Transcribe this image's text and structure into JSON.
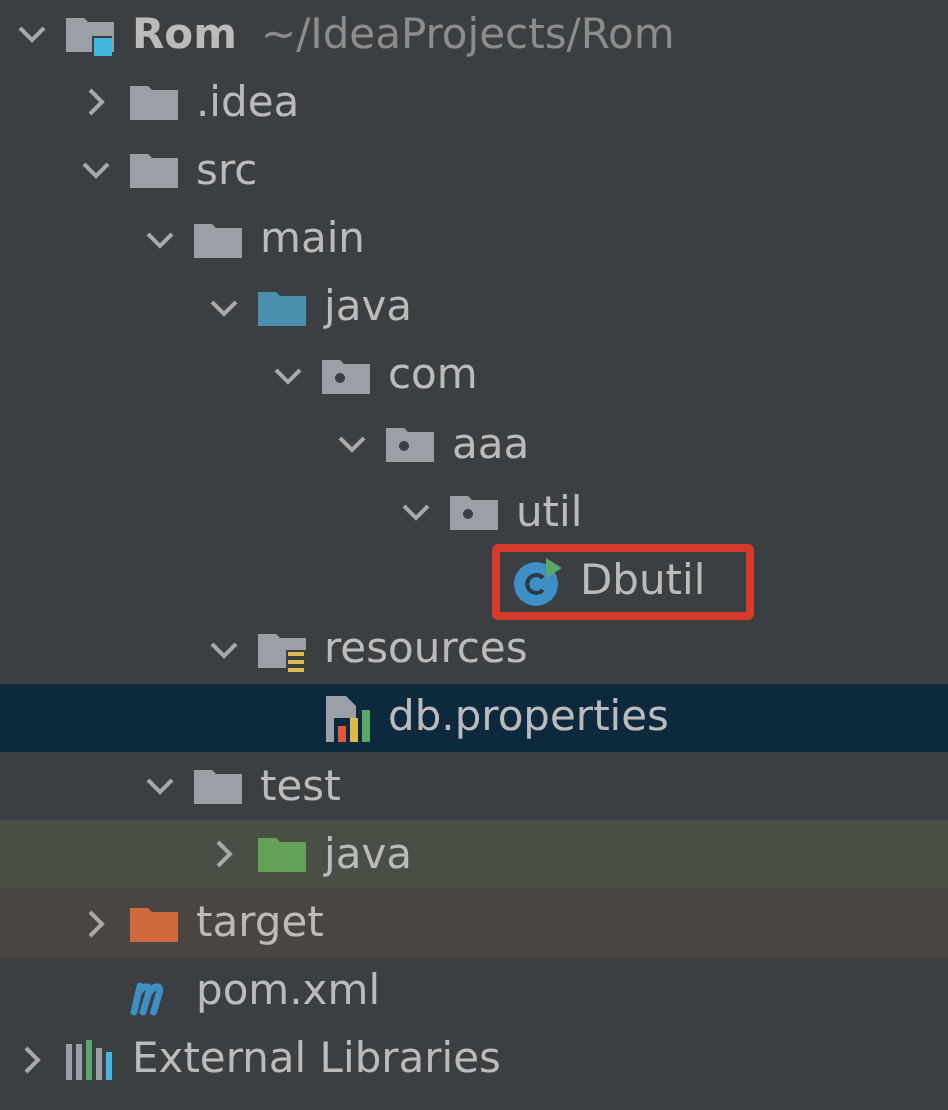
{
  "project_tree": [
    {
      "name": "Rom",
      "path": "~/IdeaProjects/Rom",
      "kind": "project",
      "expanded": true,
      "children": [
        {
          "name": ".idea",
          "kind": "folder",
          "expanded": false
        },
        {
          "name": "src",
          "kind": "folder",
          "expanded": true,
          "children": [
            {
              "name": "main",
              "kind": "folder",
              "expanded": true,
              "children": [
                {
                  "name": "java",
                  "kind": "source-root",
                  "expanded": true,
                  "children": [
                    {
                      "name": "com",
                      "kind": "package",
                      "expanded": true,
                      "children": [
                        {
                          "name": "aaa",
                          "kind": "package",
                          "expanded": true,
                          "children": [
                            {
                              "name": "util",
                              "kind": "package",
                              "expanded": true,
                              "children": [
                                {
                                  "name": "Dbutil",
                                  "kind": "class",
                                  "boxed": true,
                                  "selected": false
                                }
                              ]
                            }
                          ]
                        }
                      ]
                    }
                  ]
                },
                {
                  "name": "resources",
                  "kind": "resources-root",
                  "expanded": true,
                  "children": [
                    {
                      "name": "db.properties",
                      "kind": "properties",
                      "selected": true
                    }
                  ]
                }
              ]
            },
            {
              "name": "test",
              "kind": "folder",
              "expanded": true,
              "children": [
                {
                  "name": "java",
                  "kind": "test-root",
                  "expanded": false
                }
              ]
            }
          ]
        },
        {
          "name": "target",
          "kind": "excluded",
          "expanded": false
        },
        {
          "name": "pom.xml",
          "kind": "maven",
          "selected": false
        }
      ]
    },
    {
      "name": "External Libraries",
      "kind": "libraries",
      "expanded": false
    }
  ]
}
